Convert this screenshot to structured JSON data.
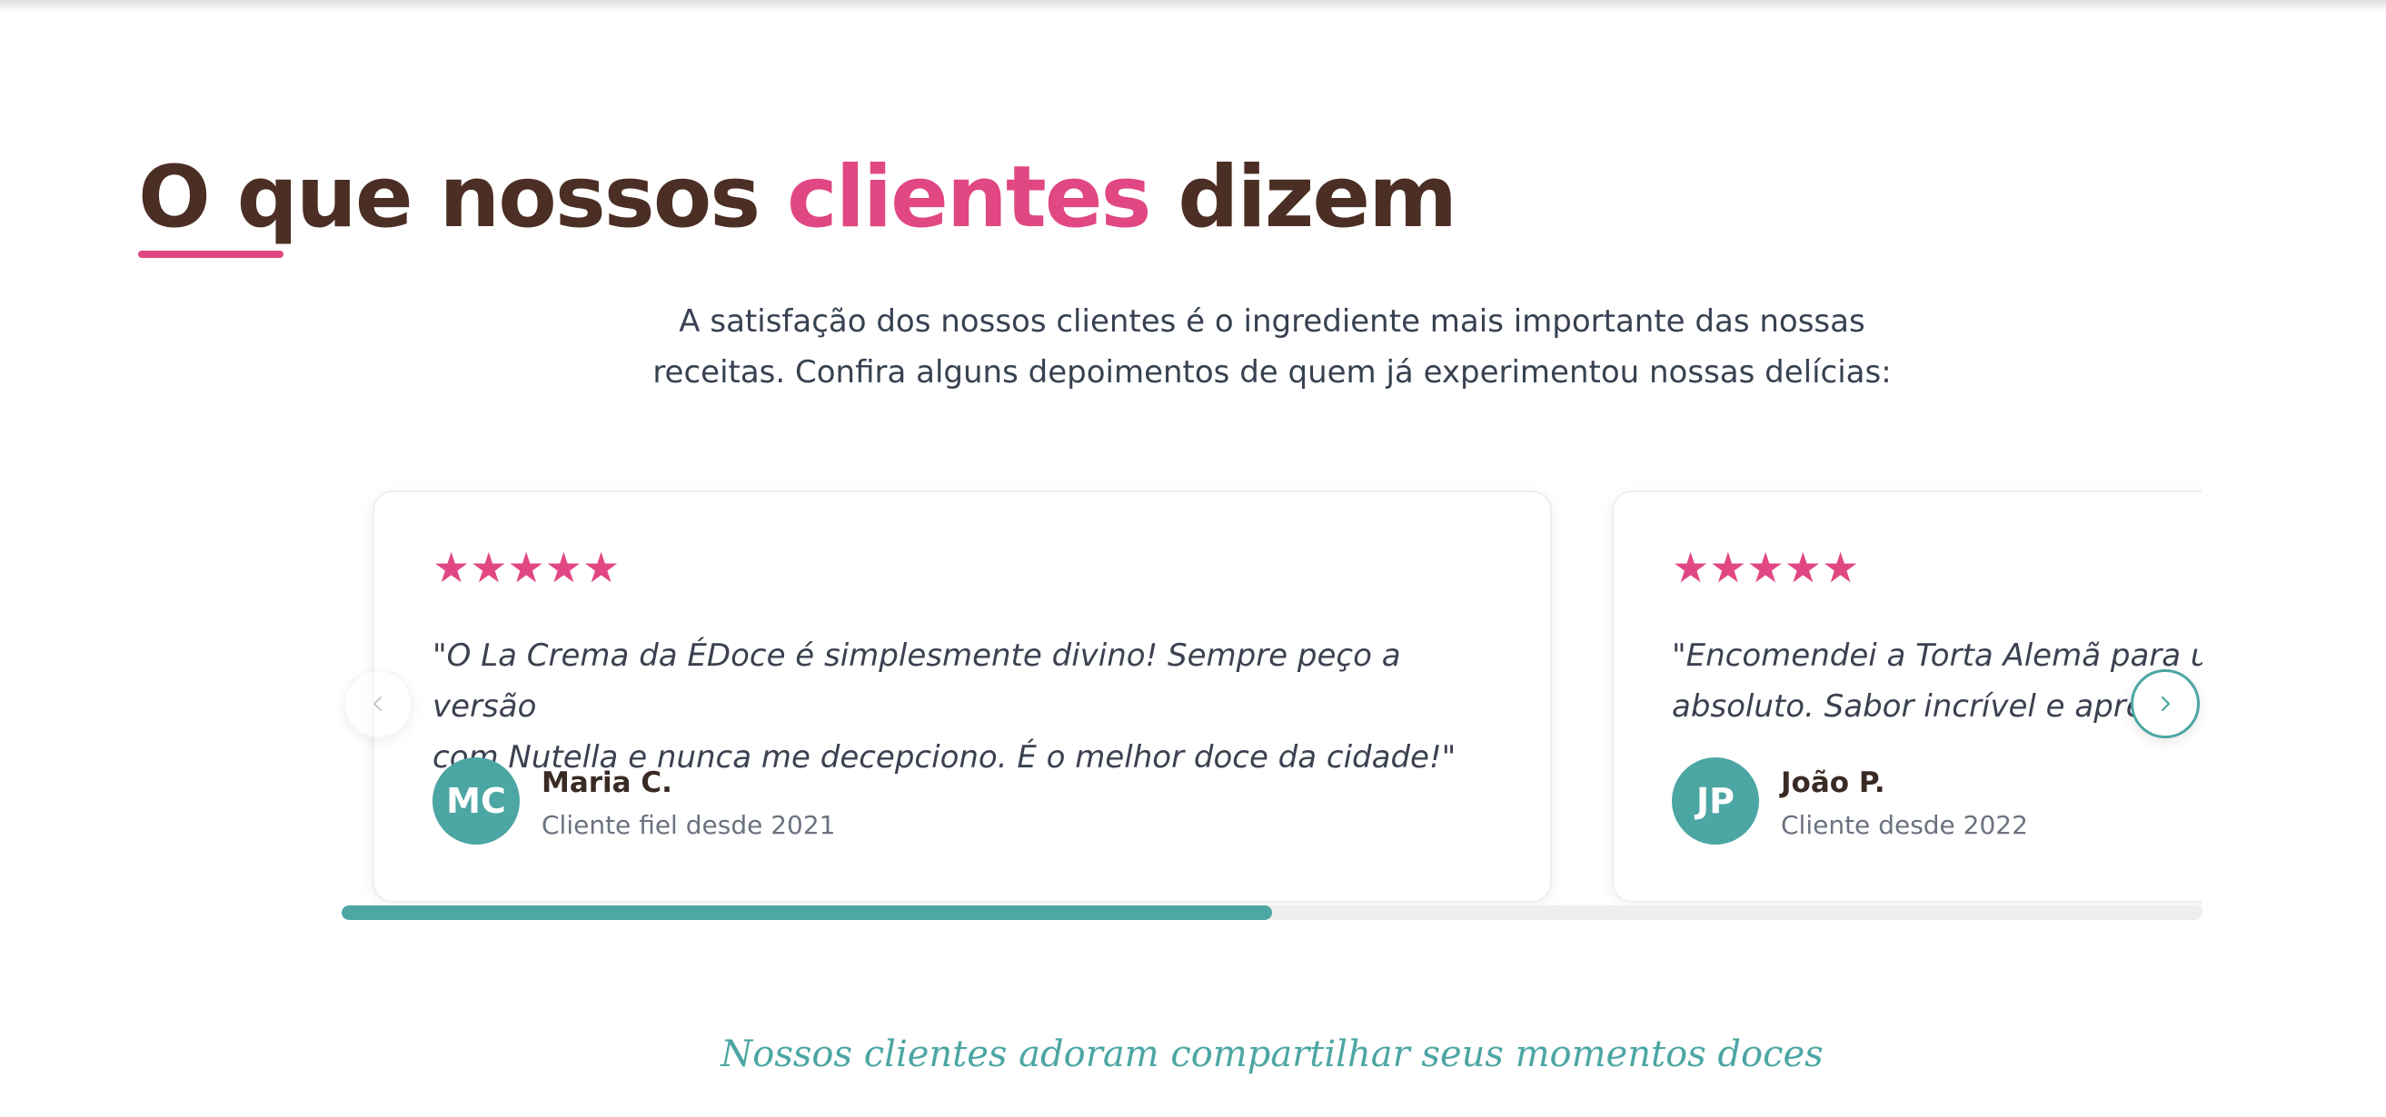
{
  "section": {
    "heading_part1": "O que nossos ",
    "heading_accent": "clientes",
    "heading_part2": " dizem",
    "intro_line1": "A satisfação dos nossos clientes é o ingrediente mais importante das nossas",
    "intro_line2": "receitas. Confira alguns depoimentos de quem já experimentou nossas delícias:",
    "tagline": "Nossos clientes adoram compartilhar seus momentos doces"
  },
  "testimonials": [
    {
      "rating": 5,
      "stars": "★★★★★",
      "quote_line1": "\"O La Crema da ÉDoce é simplesmente divino! Sempre peço a versão",
      "quote_line2": "com Nutella e nunca me decepciono. É o melhor doce da cidade!\"",
      "initials": "MC",
      "name": "Maria C.",
      "since": "Cliente fiel desde 2021"
    },
    {
      "rating": 5,
      "stars": "★★★★★",
      "quote_line1": "\"Encomendei a Torta Alemã para um",
      "quote_line2": "absoluto. Sabor incrível e apres",
      "initials": "JP",
      "name": "João P.",
      "since": "Cliente desde 2022"
    }
  ],
  "carousel": {
    "progress": 0.5,
    "prev_icon": "chevron-left-icon",
    "next_icon": "chevron-right-icon"
  },
  "colors": {
    "brown": "#4b2e24",
    "pink": "#e04783",
    "teal": "#4ca6a3"
  }
}
